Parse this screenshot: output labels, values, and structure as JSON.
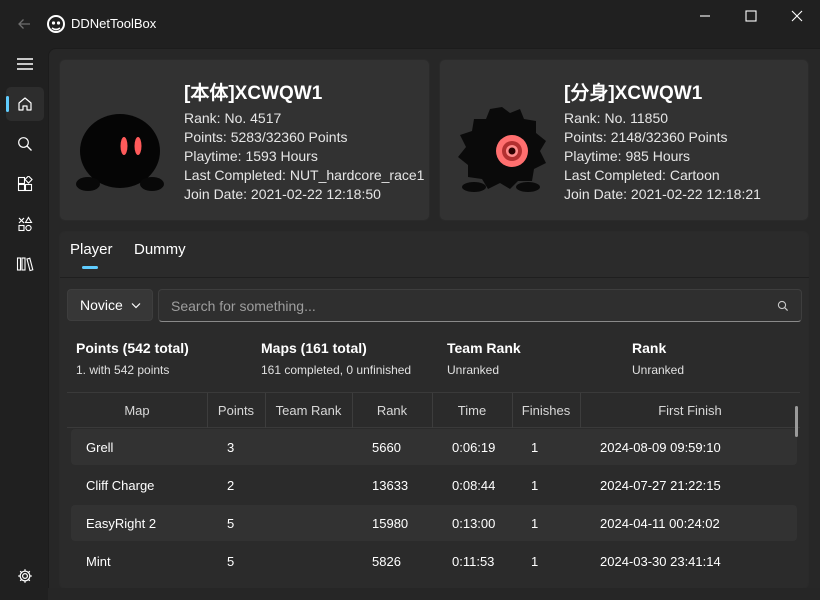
{
  "app": {
    "title": "DDNetToolBox",
    "back_icon": "back-arrow-icon",
    "logo_icon": "app-logo-icon"
  },
  "window_controls": {
    "minimize_icon": "minimize-icon",
    "maximize_icon": "maximize-icon",
    "close_icon": "close-icon"
  },
  "sidebar": {
    "items": [
      {
        "name": "menu",
        "icon": "hamburger-menu-icon"
      },
      {
        "name": "home",
        "icon": "home-icon",
        "active": true
      },
      {
        "name": "search",
        "icon": "search-icon"
      },
      {
        "name": "apps",
        "icon": "apps-icon"
      },
      {
        "name": "tools",
        "icon": "shapes-icon"
      },
      {
        "name": "library",
        "icon": "library-icon"
      }
    ],
    "settings_icon": "gear-icon"
  },
  "player_card": {
    "title": "[本体]XCWQW1",
    "rank": "Rank: No. 4517",
    "points": "Points: 5283/32360 Points",
    "playtime": "Playtime: 1593 Hours",
    "last_completed": "Last Completed: NUT_hardcore_race1",
    "join_date": "Join Date: 2021-02-22 12:18:50"
  },
  "dummy_card": {
    "title": "[分身]XCWQW1",
    "rank": "Rank: No. 11850",
    "points": "Points: 2148/32360 Points",
    "playtime": "Playtime: 985 Hours",
    "last_completed": "Last Completed: Cartoon",
    "join_date": "Join Date: 2021-02-22 12:18:21"
  },
  "tabs": {
    "player": "Player",
    "dummy": "Dummy",
    "selected": "Player"
  },
  "filter": {
    "selected": "Novice",
    "chevron_icon": "chevron-down-icon"
  },
  "search": {
    "placeholder": "Search for something...",
    "value": "",
    "icon": "search-icon"
  },
  "stats": {
    "points_label": "Points (542 total)",
    "points_value": "1. with 542 points",
    "maps_label": "Maps (161 total)",
    "maps_value": "161 completed, 0 unfinished",
    "team_rank_label": "Team Rank",
    "team_rank_value": "Unranked",
    "rank_label": "Rank",
    "rank_value": "Unranked"
  },
  "table": {
    "headers": [
      "Map",
      "Points",
      "Team Rank",
      "Rank",
      "Time",
      "Finishes",
      "First Finish"
    ],
    "rows": [
      [
        "Grell",
        "3",
        "",
        "5660",
        "0:06:19",
        "1",
        "2024-08-09 09:59:10"
      ],
      [
        "Cliff Charge",
        "2",
        "",
        "13633",
        "0:08:44",
        "1",
        "2024-07-27 21:22:15"
      ],
      [
        "EasyRight 2",
        "5",
        "",
        "15980",
        "0:13:00",
        "1",
        "2024-04-11 00:24:02"
      ],
      [
        "Mint",
        "5",
        "",
        "5826",
        "0:11:53",
        "1",
        "2024-03-30 23:41:14"
      ]
    ]
  },
  "colors": {
    "accent": "#60cdff",
    "background": "#202020",
    "card": "#323232"
  }
}
